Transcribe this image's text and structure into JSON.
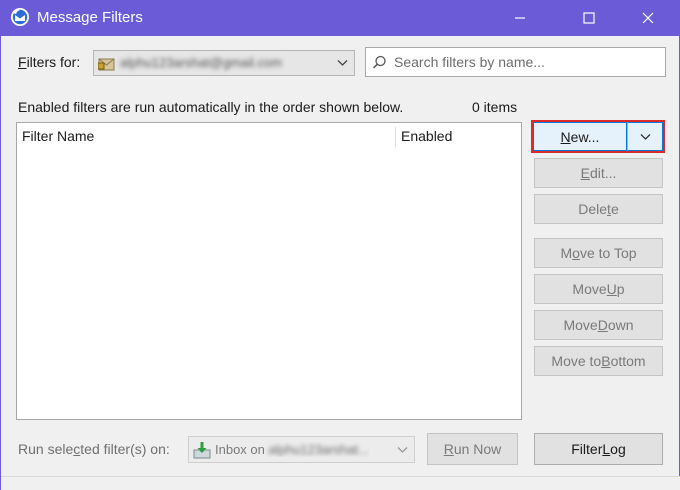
{
  "window": {
    "title": "Message Filters",
    "app_icon": "thunderbird-icon",
    "controls": [
      "minimize-icon",
      "maximize-icon",
      "close-icon"
    ]
  },
  "filters_for": {
    "label_pre": "",
    "label_accel": "F",
    "label_post": "ilters for:",
    "account": "alphu123arshat@gmail.com",
    "account_icon": "mail-account-icon"
  },
  "search": {
    "placeholder": "Search filters by name...",
    "value": "",
    "icon": "search-icon"
  },
  "info": {
    "text": "Enabled filters are run automatically in the order shown below.",
    "count": "0 items"
  },
  "table": {
    "columns": [
      "Filter Name",
      "Enabled"
    ],
    "rows": []
  },
  "buttons": {
    "new": {
      "accel": "N",
      "rest": "ew..."
    },
    "edit": {
      "accel": "E",
      "rest": "dit..."
    },
    "delete": {
      "pre": "Dele",
      "accel": "t",
      "rest": "e"
    },
    "move_top": {
      "pre": "M",
      "accel": "o",
      "rest": "ve to Top"
    },
    "move_up": {
      "pre": "Move ",
      "accel": "U",
      "rest": "p"
    },
    "move_down": {
      "pre": "Move ",
      "accel": "D",
      "rest": "own"
    },
    "move_bottom": {
      "pre": "Move to ",
      "accel": "B",
      "rest": "ottom"
    },
    "run_now": {
      "accel": "R",
      "rest": "un Now"
    },
    "filter_log": {
      "pre": "Filter ",
      "accel": "L",
      "rest": "og"
    }
  },
  "run_selected": {
    "pre": "Run sele",
    "accel": "c",
    "post": "ted filter(s) on:",
    "folder_prefix": "Inbox on",
    "folder_account": "alphu123arshat...",
    "folder_icon": "inbox-download-icon"
  },
  "colors": {
    "titlebar": "#6b5bd6",
    "highlight": "#d92b2b",
    "focus": "#0078d7"
  }
}
